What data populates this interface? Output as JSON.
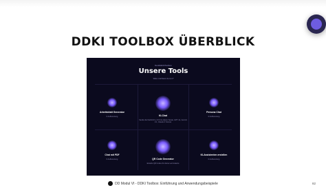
{
  "slide": {
    "title": "DDKI TOOLBOX ÜBERBLICK",
    "page_number": "82",
    "footer": "DD Modul VI - DDKI Toolbox: Einführung und Anwendungsbeispiele"
  },
  "panel": {
    "brand": "DenkfabrikToolbox",
    "title": "Unsere Tools",
    "subtitle": "Was möchtest du tun?",
    "tools": [
      {
        "name": "Arbeitsblatt Generator",
        "desc": "0 Aufbereitung",
        "icon": "sparkle-orb-icon"
      },
      {
        "name": "KI-Chat",
        "desc": "Sende die Nachricht y KI fü le davon Sowie, GPT 4o, Gemini 2.1, Claude 3 Sonnet",
        "icon": "glowing-orb-icon"
      },
      {
        "name": "Persona Chat",
        "desc": "0 Aufbereitung",
        "icon": "star-icon"
      },
      {
        "name": "Chat mit PDF",
        "desc": "0 Aufbereitung",
        "icon": "document-orb-icon"
      },
      {
        "name": "QR Code Generator",
        "desc": "Erstelle QR Codes für deine Lernmaterie",
        "icon": "qr-orb-icon"
      },
      {
        "name": "KI-Assistenten erstellen",
        "desc": "0 Aufbereitung",
        "icon": "sparkles-icon"
      }
    ]
  }
}
